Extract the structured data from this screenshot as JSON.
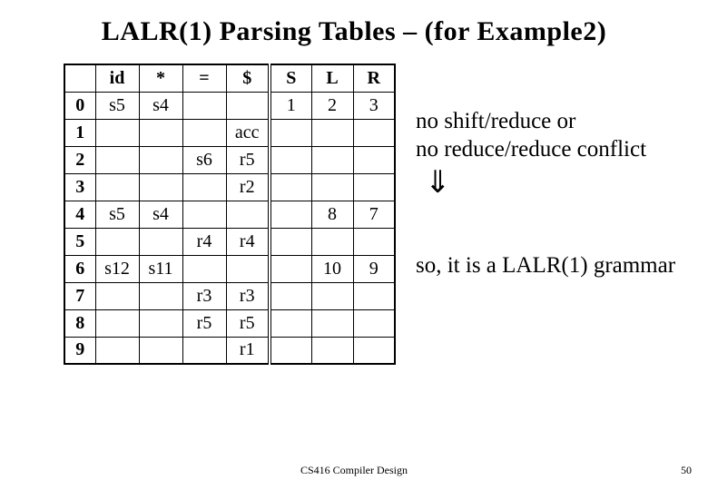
{
  "title": "LALR(1) Parsing Tables – (for Example2)",
  "headers": {
    "id": "id",
    "star": "*",
    "eq": "=",
    "dollar": "$",
    "S": "S",
    "L": "L",
    "R": "R"
  },
  "rows": [
    {
      "st": "0",
      "id": "s5",
      "star": "s4",
      "eq": "",
      "dollar": "",
      "S": "1",
      "L": "2",
      "R": "3"
    },
    {
      "st": "1",
      "id": "",
      "star": "",
      "eq": "",
      "dollar": "acc",
      "S": "",
      "L": "",
      "R": ""
    },
    {
      "st": "2",
      "id": "",
      "star": "",
      "eq": "s6",
      "dollar": "r5",
      "S": "",
      "L": "",
      "R": ""
    },
    {
      "st": "3",
      "id": "",
      "star": "",
      "eq": "",
      "dollar": "r2",
      "S": "",
      "L": "",
      "R": ""
    },
    {
      "st": "4",
      "id": "s5",
      "star": "s4",
      "eq": "",
      "dollar": "",
      "S": "",
      "L": "8",
      "R": "7"
    },
    {
      "st": "5",
      "id": "",
      "star": "",
      "eq": "r4",
      "dollar": "r4",
      "S": "",
      "L": "",
      "R": ""
    },
    {
      "st": "6",
      "id": "s12",
      "star": "s11",
      "eq": "",
      "dollar": "",
      "S": "",
      "L": "10",
      "R": "9"
    },
    {
      "st": "7",
      "id": "",
      "star": "",
      "eq": "r3",
      "dollar": "r3",
      "S": "",
      "L": "",
      "R": ""
    },
    {
      "st": "8",
      "id": "",
      "star": "",
      "eq": "r5",
      "dollar": "r5",
      "S": "",
      "L": "",
      "R": ""
    },
    {
      "st": "9",
      "id": "",
      "star": "",
      "eq": "",
      "dollar": "r1",
      "S": "",
      "L": "",
      "R": ""
    }
  ],
  "notes": {
    "line1": "no shift/reduce or",
    "line2": "no reduce/reduce conflict",
    "arrow": "⇓",
    "line3": "so, it is a LALR(1) grammar"
  },
  "footer": {
    "center": "CS416 Compiler Design",
    "page": "50"
  },
  "chart_data": {
    "type": "table",
    "title": "LALR(1) Parsing Table for Example 2",
    "action_columns": [
      "id",
      "*",
      "=",
      "$"
    ],
    "goto_columns": [
      "S",
      "L",
      "R"
    ],
    "states": [
      0,
      1,
      2,
      3,
      4,
      5,
      6,
      7,
      8,
      9
    ],
    "action": {
      "0": {
        "id": "s5",
        "*": "s4"
      },
      "1": {
        "$": "acc"
      },
      "2": {
        "=": "s6",
        "$": "r5"
      },
      "3": {
        "$": "r2"
      },
      "4": {
        "id": "s5",
        "*": "s4"
      },
      "5": {
        "=": "r4",
        "$": "r4"
      },
      "6": {
        "id": "s12",
        "*": "s11"
      },
      "7": {
        "=": "r3",
        "$": "r3"
      },
      "8": {
        "=": "r5",
        "$": "r5"
      },
      "9": {
        "$": "r1"
      }
    },
    "goto": {
      "0": {
        "S": 1,
        "L": 2,
        "R": 3
      },
      "4": {
        "L": 8,
        "R": 7
      },
      "6": {
        "L": 10,
        "R": 9
      }
    }
  }
}
